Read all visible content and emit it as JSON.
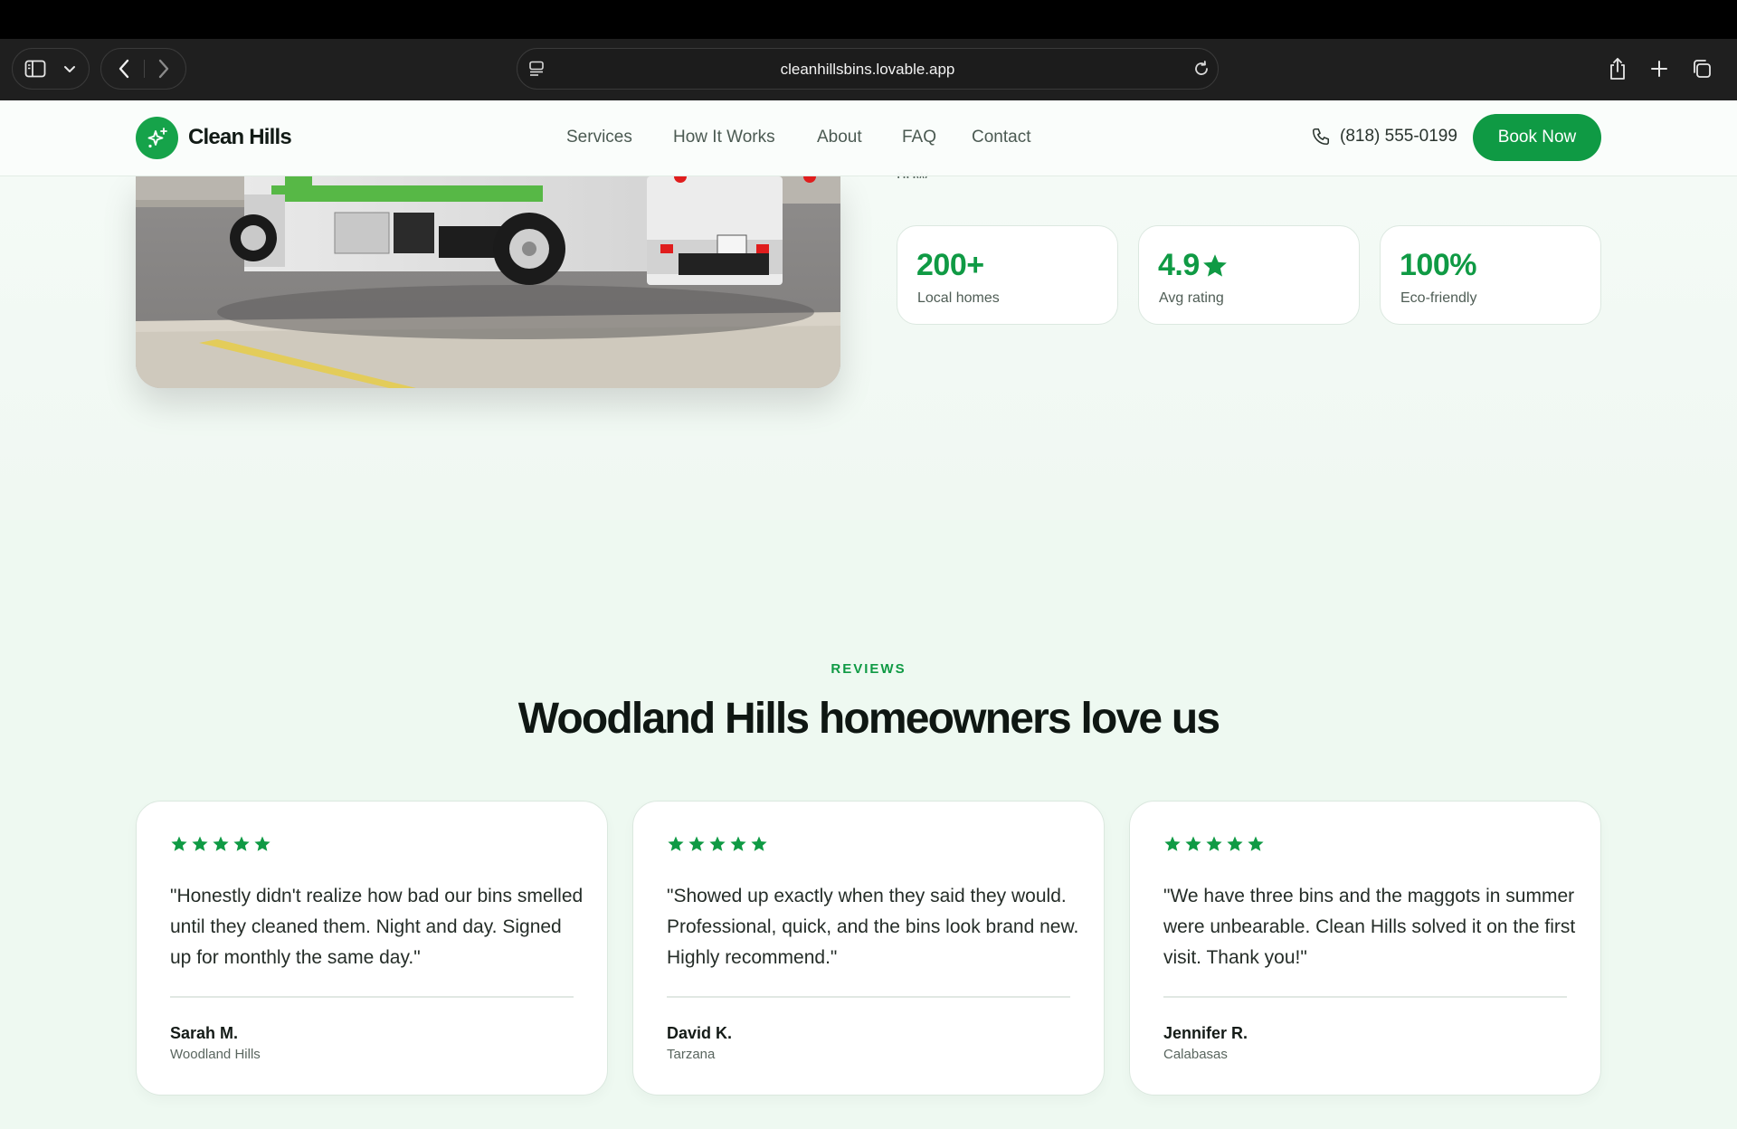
{
  "browser": {
    "url": "cleanhillsbins.lovable.app",
    "icons": [
      "sidebar-icon",
      "chevron-down-icon",
      "back-icon",
      "forward-icon",
      "page-menu-icon",
      "reload-icon",
      "share-icon",
      "new-tab-icon",
      "tabs-overview-icon"
    ]
  },
  "header": {
    "brand": "Clean Hills",
    "nav": [
      "Services",
      "How It Works",
      "About",
      "FAQ",
      "Contact"
    ],
    "phone": "(818) 555-0199",
    "cta": "Book Now"
  },
  "hero": {
    "cut_text": "now.",
    "stats": [
      {
        "value": "200+",
        "label": "Local homes"
      },
      {
        "value": "4.9",
        "label": "Avg rating",
        "icon": "star-icon"
      },
      {
        "value": "100%",
        "label": "Eco-friendly"
      }
    ]
  },
  "reviews": {
    "eyebrow": "REVIEWS",
    "headline": "Woodland Hills homeowners love us",
    "items": [
      {
        "rating": 5,
        "quote": "\"Honestly didn't realize how bad our bins smelled until they cleaned them. Night and day. Signed up for monthly the same day.\"",
        "name": "Sarah M.",
        "location": "Woodland Hills"
      },
      {
        "rating": 5,
        "quote": "\"Showed up exactly when they said they would. Professional, quick, and the bins look brand new. Highly recommend.\"",
        "name": "David K.",
        "location": "Tarzana"
      },
      {
        "rating": 5,
        "quote": "\"We have three bins and the maggots in summer were unbearable. Clean Hills solved it on the first visit. Thank you!\"",
        "name": "Jennifer R.",
        "location": "Calabasas"
      }
    ]
  },
  "colors": {
    "brand": "#0f9a44",
    "page_background": "#eef9f1",
    "chrome": "#1f1f1f"
  }
}
